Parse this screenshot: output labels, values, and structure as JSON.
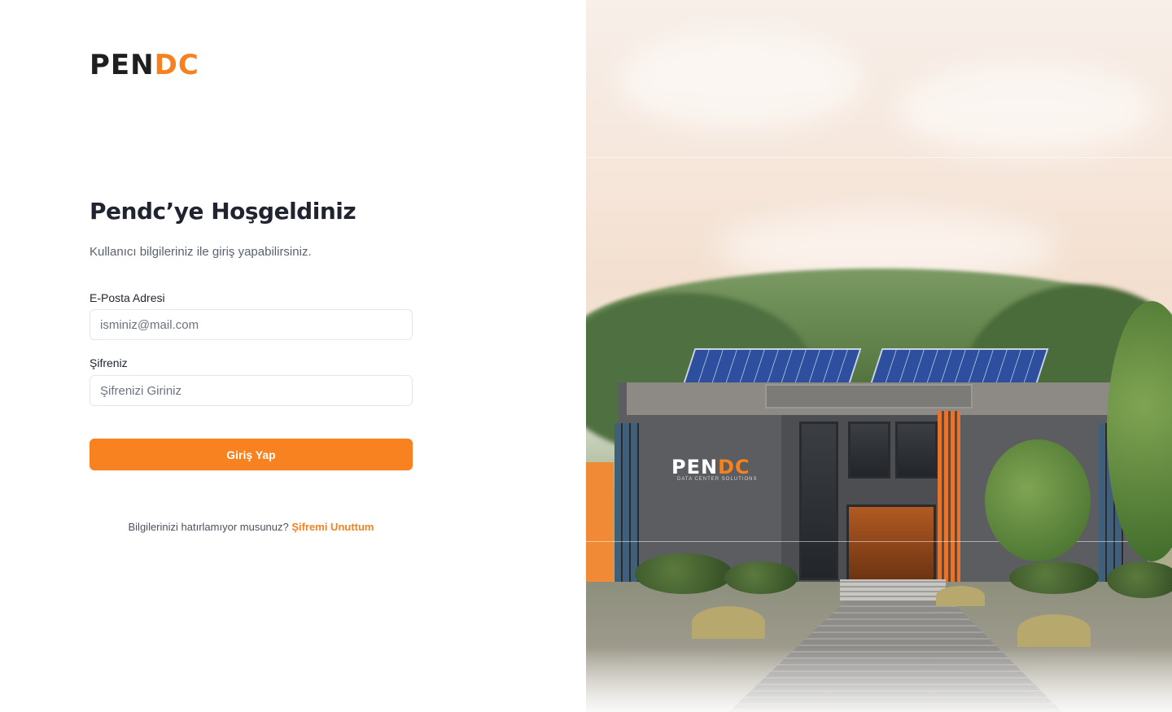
{
  "brand": {
    "logo_dark": "PEN",
    "logo_orange": "DC",
    "accent_color": "#f7821f"
  },
  "login": {
    "title": "Pendc’ye Hoşgeldiniz",
    "subtitle": "Kullanıcı bilgileriniz ile giriş yapabilirsiniz.",
    "email_label": "E-Posta Adresi",
    "email_placeholder": "isminiz@mail.com",
    "email_value": "",
    "password_label": "Şifreniz",
    "password_placeholder": "Şifrenizi Giriniz",
    "password_value": "",
    "submit_label": "Giriş Yap",
    "forgot_prompt": "Bilgilerinizi hatırlamıyor musunuz?",
    "forgot_link": "Şifremi Unuttum"
  },
  "hero": {
    "sign_dark": "PEN",
    "sign_orange": "DC",
    "sign_sub": "DATA CENTER SOLUTIONS"
  }
}
